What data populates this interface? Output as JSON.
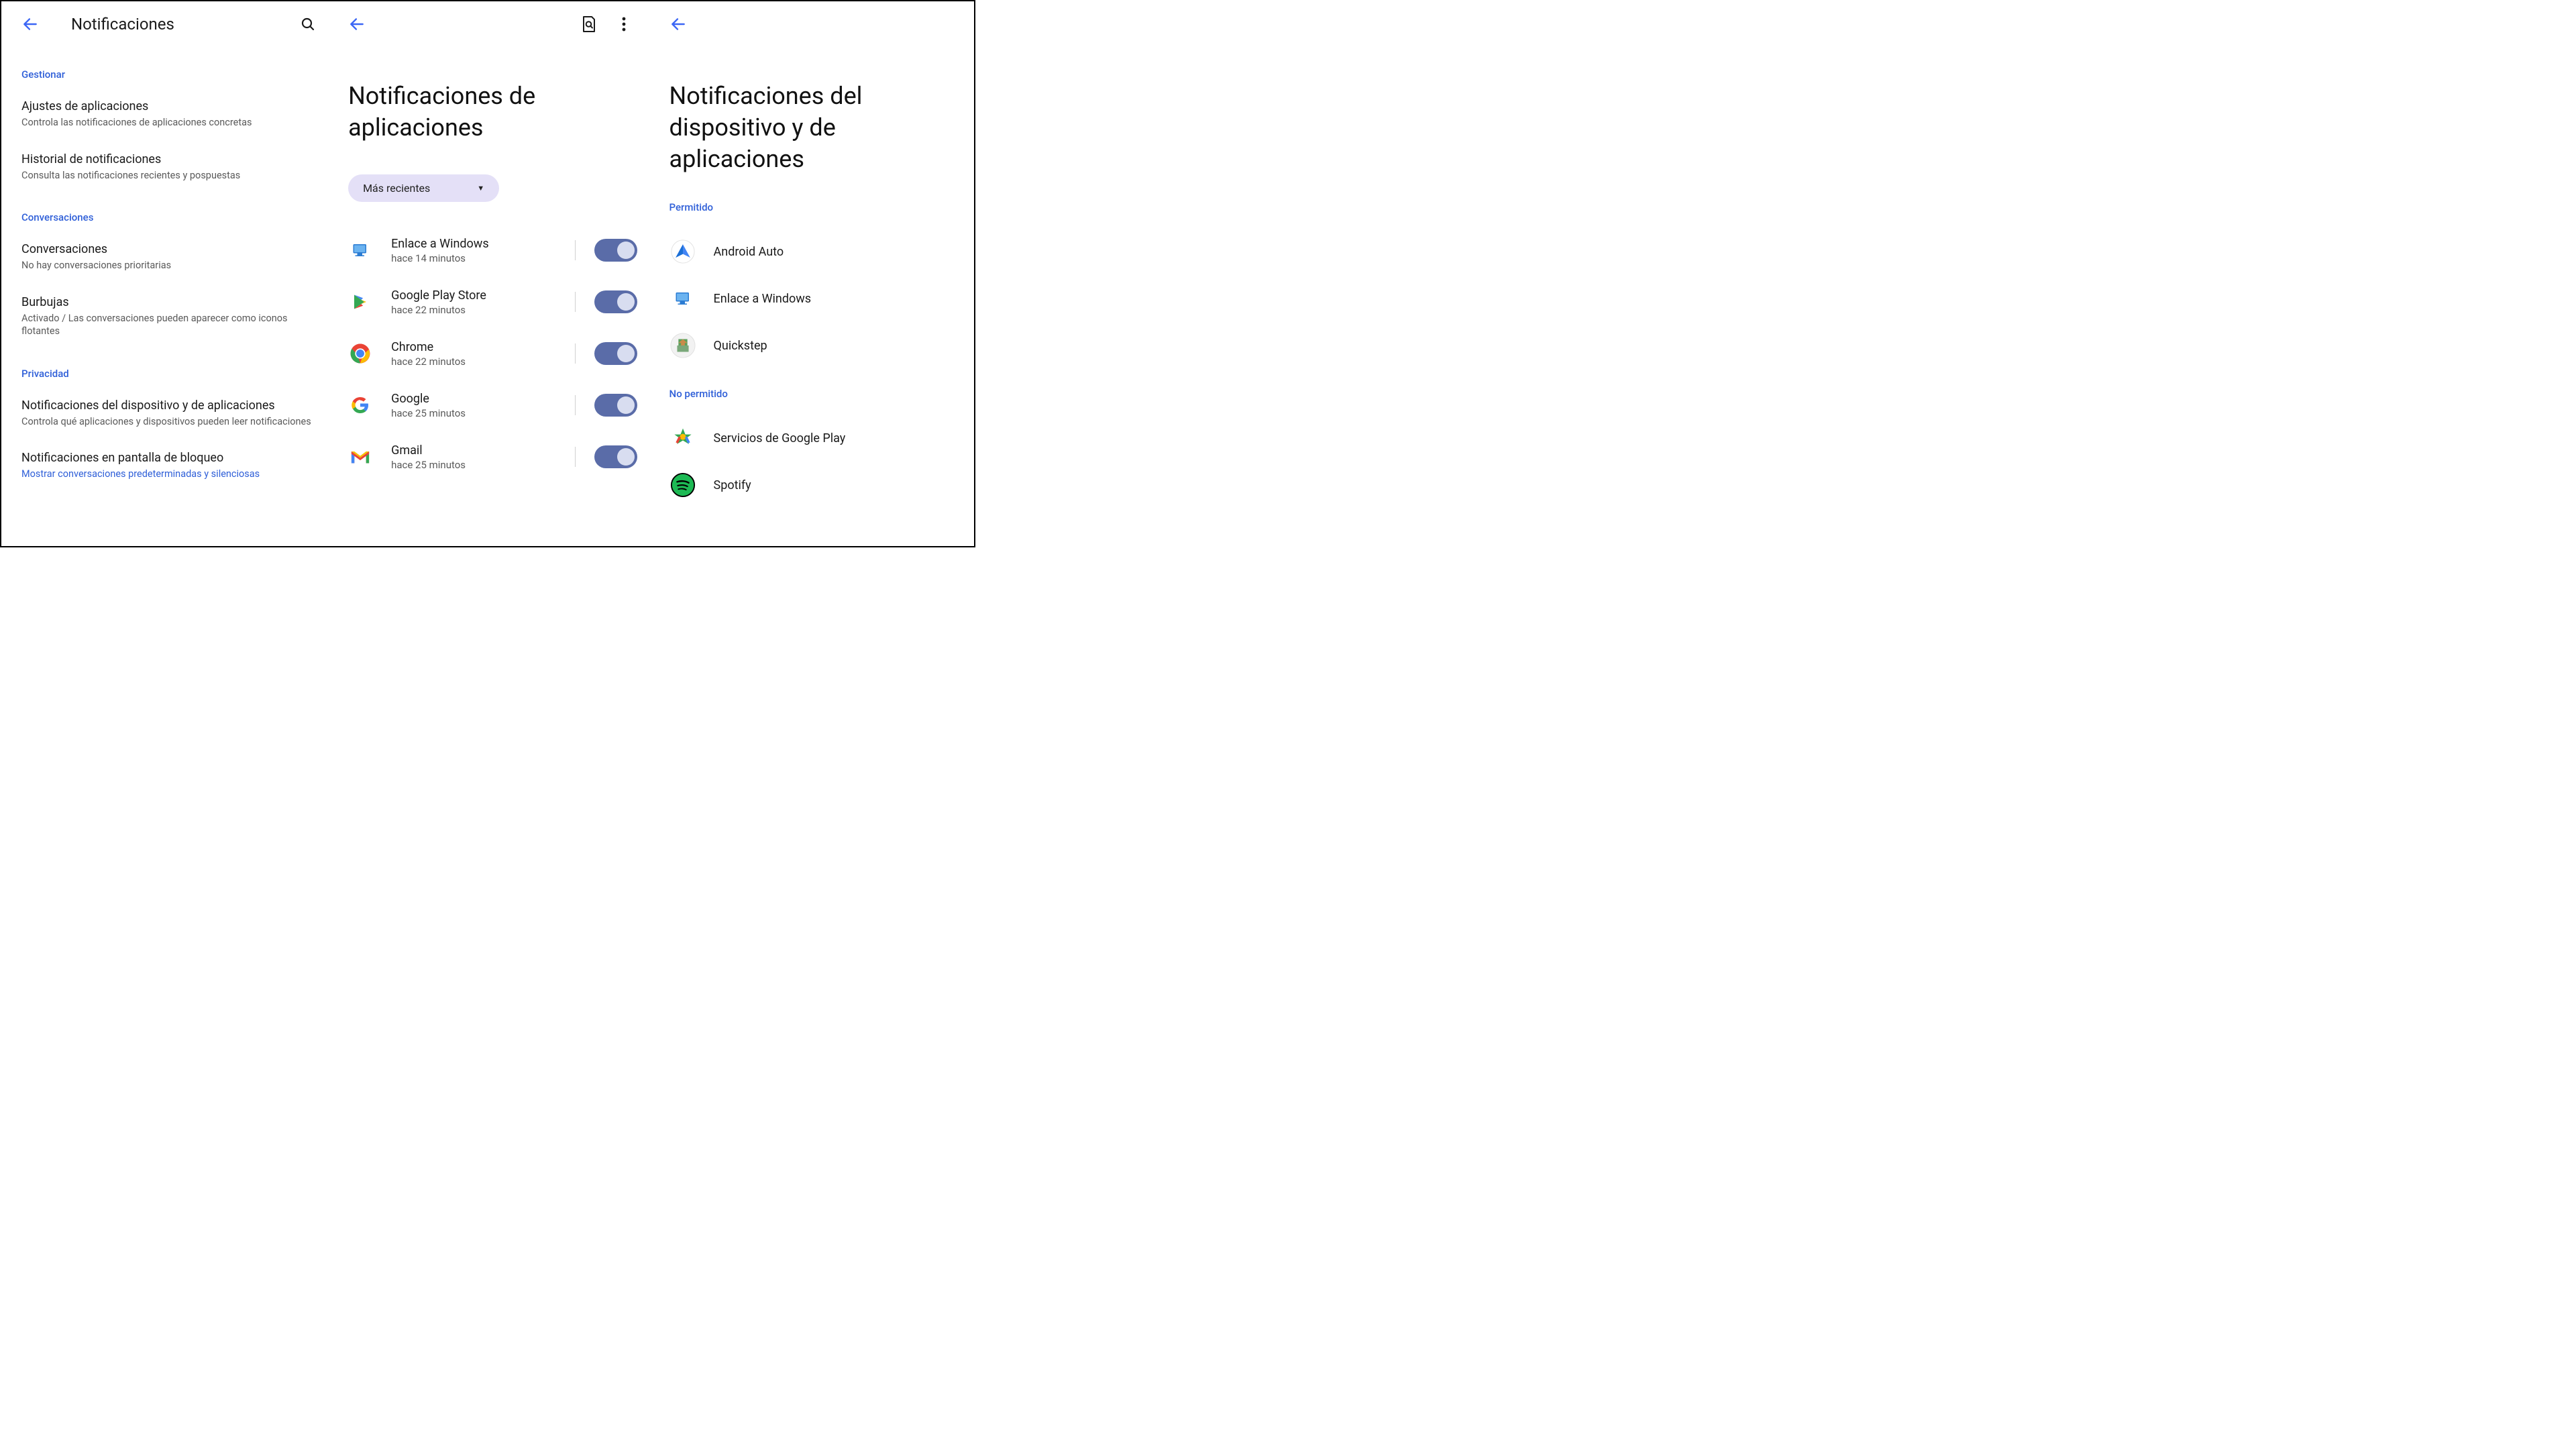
{
  "panel1": {
    "title": "Notificaciones",
    "sections": {
      "manage": {
        "header": "Gestionar",
        "items": [
          {
            "title": "Ajustes de aplicaciones",
            "sub": "Controla las notificaciones de aplicaciones concretas"
          },
          {
            "title": "Historial de notificaciones",
            "sub": "Consulta las notificaciones recientes y pospuestas"
          }
        ]
      },
      "conversations": {
        "header": "Conversaciones",
        "items": [
          {
            "title": "Conversaciones",
            "sub": "No hay conversaciones prioritarias"
          },
          {
            "title": "Burbujas",
            "sub": "Activado / Las conversaciones pueden aparecer como iconos flotantes"
          }
        ]
      },
      "privacy": {
        "header": "Privacidad",
        "items": [
          {
            "title": "Notificaciones del dispositivo y de aplicaciones",
            "sub": "Controla qué aplicaciones y dispositivos pueden leer notificaciones"
          },
          {
            "title": "Notificaciones en pantalla de bloqueo",
            "sub": "Mostrar conversaciones predeterminadas y silenciosas",
            "sublink": true
          }
        ]
      }
    }
  },
  "panel2": {
    "title": "Notificaciones de aplicaciones",
    "filter": "Más recientes",
    "apps": [
      {
        "name": "Enlace a Windows",
        "time": "hace 14 minutos",
        "icon": "windows-link"
      },
      {
        "name": "Google Play Store",
        "time": "hace 22 minutos",
        "icon": "play-store"
      },
      {
        "name": "Chrome",
        "time": "hace 22 minutos",
        "icon": "chrome"
      },
      {
        "name": "Google",
        "time": "hace 25 minutos",
        "icon": "google-g"
      },
      {
        "name": "Gmail",
        "time": "hace 25 minutos",
        "icon": "gmail"
      }
    ]
  },
  "panel3": {
    "title": "Notificaciones del dispositivo y de aplicaciones",
    "allowed_header": "Permitido",
    "allowed": [
      {
        "name": "Android Auto",
        "icon": "android-auto"
      },
      {
        "name": "Enlace a Windows",
        "icon": "windows-link"
      },
      {
        "name": "Quickstep",
        "icon": "quickstep"
      }
    ],
    "not_allowed_header": "No permitido",
    "not_allowed": [
      {
        "name": "Servicios de Google Play",
        "icon": "play-services"
      },
      {
        "name": "Spotify",
        "icon": "spotify"
      }
    ]
  }
}
